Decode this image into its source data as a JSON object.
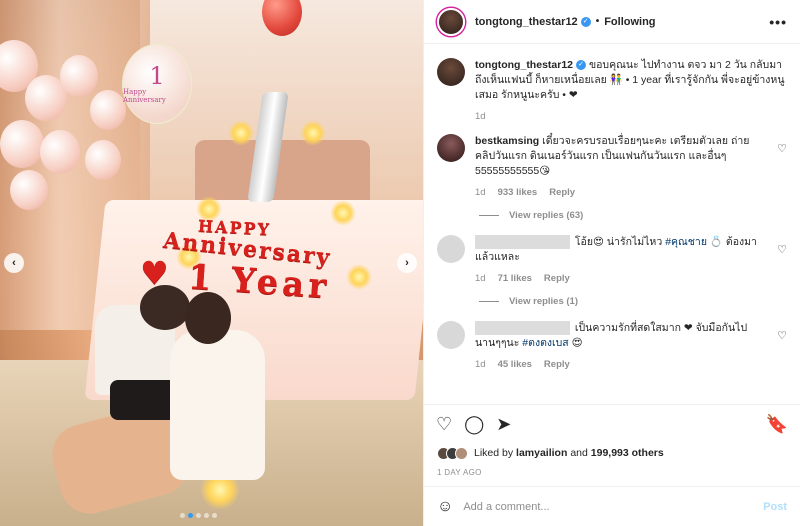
{
  "post": {
    "username": "tongtong_thestar12",
    "follow_state": "Following",
    "separator": "•",
    "more_label": "•••",
    "caption": {
      "username": "tongtong_thestar12",
      "text": "ขอบคุณนะ ไปทำงาน ตจว มา 2 วัน กลับมาถึงเห็นแฟนบี้ ก็หายเหนื่อยเลย 👫 • 1 year ที่เรารู้จักกัน พี่จะอยู่ข้างหนูเสมอ รักหนูนะครับ • ❤",
      "age": "1d"
    },
    "comments": [
      {
        "username": "bestkamsing",
        "text": "เดี๋ยวจะครบรอบเรื่อยๆนะคะ เตรียมตัวเลย ถ่ายคลิปวันแรก ดินเนอร์วันแรก เป็นแฟนกันวันแรก และอื่นๆ 55555555555😘",
        "age": "1d",
        "likes": "933 likes",
        "reply": "Reply",
        "view_replies": "View replies (63)"
      },
      {
        "username_redacted": true,
        "text_prefix": "โอ้ย😍 น่ารักไม่ไหว",
        "tag": "#คุณชาย",
        "text_suffix": "💍 ต้องมาแล้วแหละ",
        "age": "1d",
        "likes": "71 likes",
        "reply": "Reply",
        "view_replies": "View replies (1)"
      },
      {
        "username_redacted": true,
        "text_prefix": "เป็นความรักที่สดใสมาก ❤ จับมือกันไปนานๆๆนะ",
        "tag": "#ตงตงเบส",
        "text_suffix": "😍",
        "age": "1d",
        "likes": "45 likes",
        "reply": "Reply"
      }
    ],
    "liked_by": {
      "prefix": "Liked by",
      "user": "lamyailion",
      "middle": "and",
      "others": "199,993 others"
    },
    "time_ago": "1 DAY AGO",
    "add_comment_placeholder": "Add a comment...",
    "post_button": "Post"
  },
  "media": {
    "balloon_text": "Happy Anniversary",
    "balloon_number": "1",
    "bed_line1": "HAPPY",
    "bed_line2": "Anniversary",
    "bed_line3": "1 Year",
    "prev_glyph": "‹",
    "next_glyph": "›"
  },
  "icons": {
    "heart": "♡",
    "comment": "◯",
    "share": "➤",
    "bookmark": "🔖",
    "smiley": "☺"
  },
  "colors": {
    "accent_blue": "#3897f0",
    "link_blue": "#00376b",
    "post_button_disabled": "#b2dffc",
    "story_ring": "#d6249f"
  }
}
